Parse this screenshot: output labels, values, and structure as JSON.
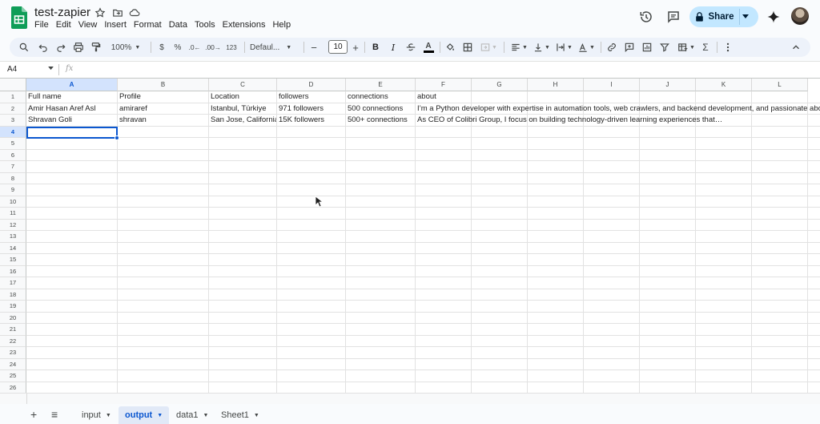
{
  "app": {
    "title": "test-zapier",
    "menu": [
      "File",
      "Edit",
      "View",
      "Insert",
      "Format",
      "Data",
      "Tools",
      "Extensions",
      "Help"
    ],
    "share_label": "Share"
  },
  "toolbar": {
    "zoom": "100%",
    "currency": "$",
    "percent": "%",
    "decrease_decimal": ".0",
    "increase_decimal": ".00",
    "number_format": "123",
    "font": "Defaul...",
    "font_size": "10",
    "minus": "−",
    "plus": "+",
    "bold": "B",
    "italic": "I",
    "text_color_letter": "A",
    "sum": "Σ"
  },
  "formula_bar": {
    "name_box": "A4",
    "fx": "fx",
    "value": ""
  },
  "grid": {
    "columns": [
      "A",
      "B",
      "C",
      "D",
      "E",
      "F",
      "G",
      "H",
      "I",
      "J",
      "K",
      "L"
    ],
    "selected_column": "A",
    "selected_row": "4",
    "rows": [
      "1",
      "2",
      "3",
      "4",
      "5",
      "6",
      "7",
      "8",
      "9",
      "10",
      "11",
      "12",
      "13",
      "14",
      "15",
      "16",
      "17",
      "18",
      "19",
      "20",
      "21",
      "22",
      "23",
      "24",
      "25",
      "26"
    ],
    "cells": [
      [
        "Full name",
        "Profile",
        "Location",
        "followers",
        "connections",
        "about"
      ],
      [
        "Amir Hasan Aref Asl",
        "amiraref",
        "Istanbul, Türkiye",
        "971 followers",
        "500 connections",
        "I’m a Python developer with expertise in automation tools, web crawlers, and backend development, and passionate abo"
      ],
      [
        "Shravan Goli",
        "shravan",
        "San Jose, California",
        "15K followers",
        "500+ connections",
        "As CEO of Colibri Group, I focus on building technology-driven learning experiences that…"
      ]
    ]
  },
  "sheets": {
    "add": "+",
    "all_sheets": "≡",
    "tabs": [
      {
        "label": "input",
        "active": false
      },
      {
        "label": "output",
        "active": true
      },
      {
        "label": "data1",
        "active": false
      },
      {
        "label": "Sheet1",
        "active": false
      }
    ]
  },
  "colors": {
    "accent": "#0b57d0",
    "share_bg": "#c2e7ff",
    "toolbar_bg": "#edf2fa",
    "selected_header": "#d3e3fd",
    "sheets_green": "#0f9d58"
  }
}
